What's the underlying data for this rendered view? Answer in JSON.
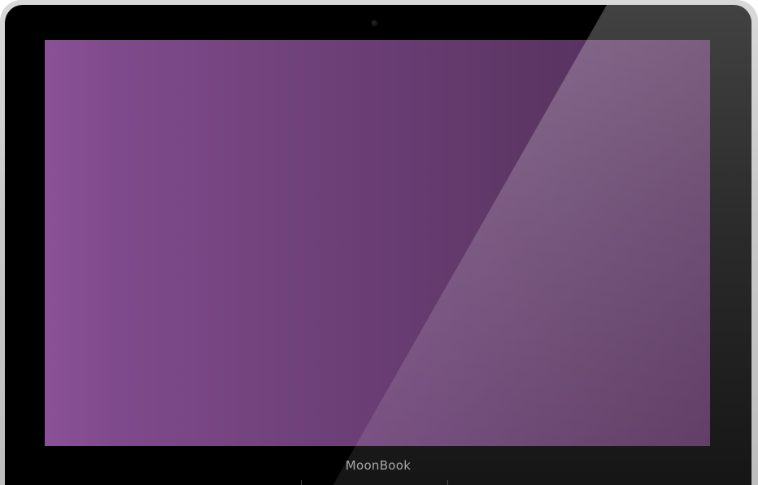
{
  "device": {
    "brand_label": "MoonBook",
    "screen": {
      "state": "blank",
      "gradient_colors": [
        "#8b5297",
        "#502a56"
      ]
    },
    "bezel_color": "#000000",
    "shell_color": "#c9c9c9"
  }
}
